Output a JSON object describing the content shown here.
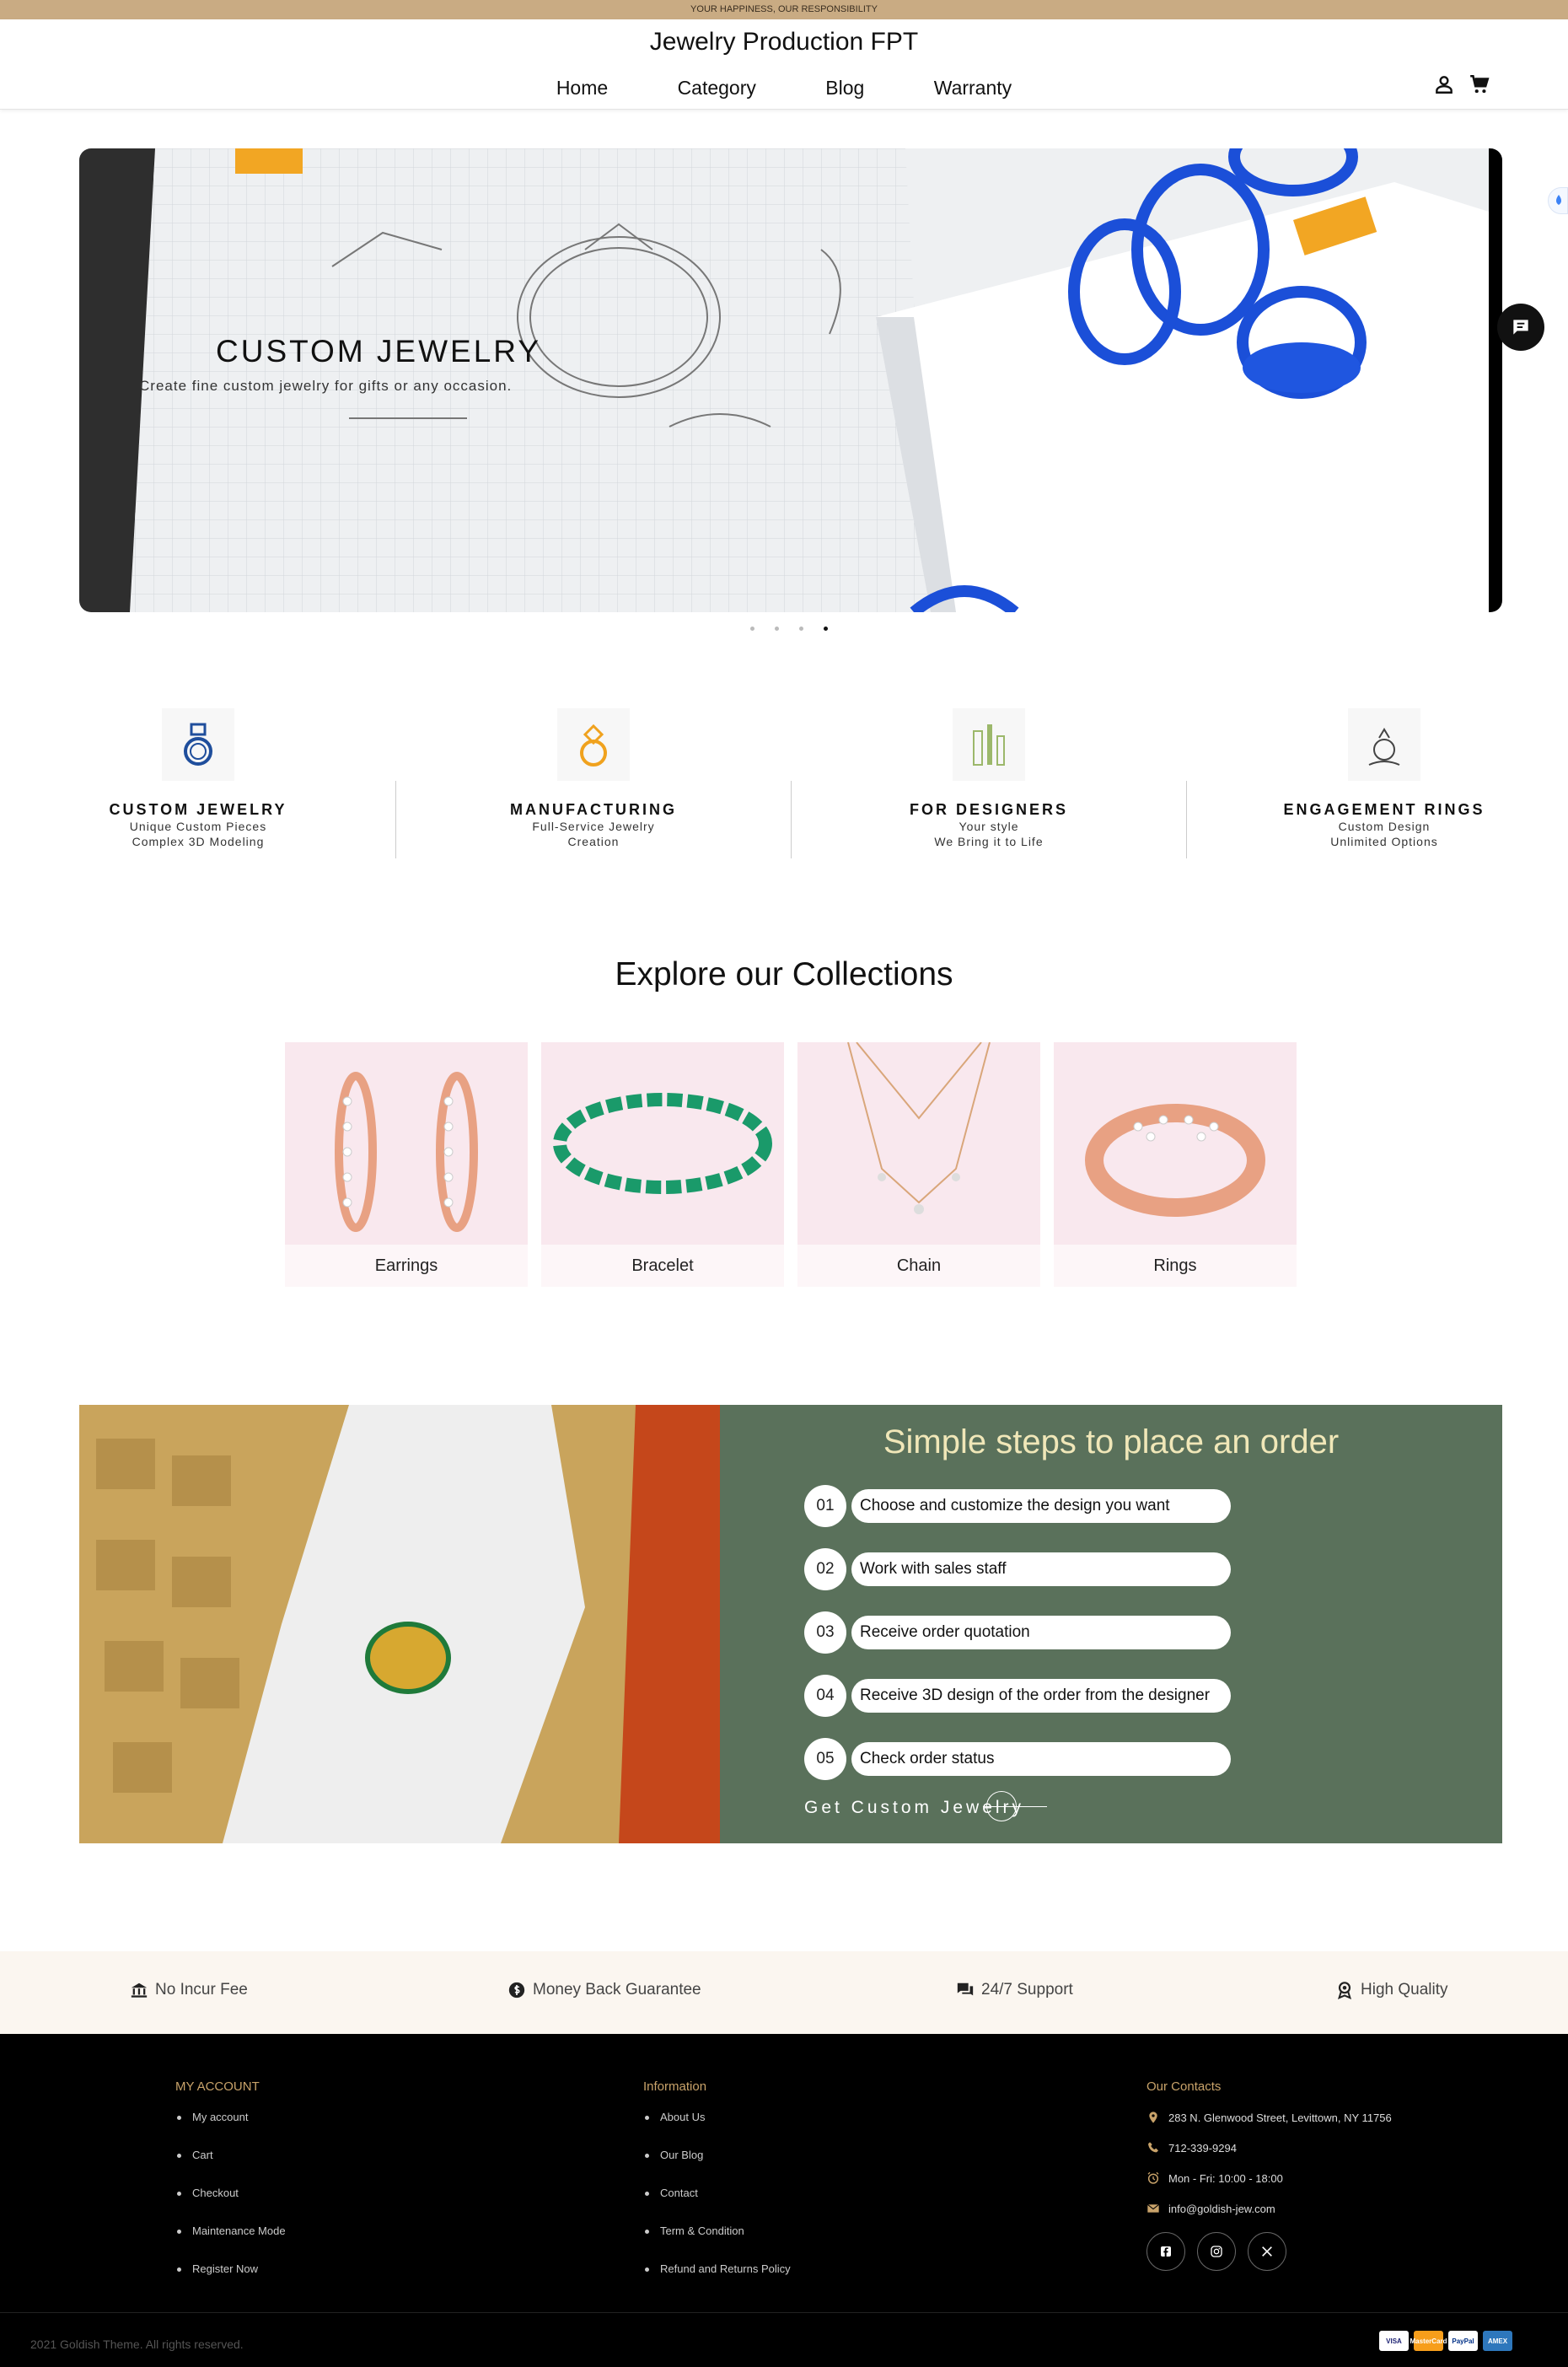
{
  "announcement": "YOUR HAPPINESS, OUR RESPONSIBILITY",
  "header": {
    "brand": "Jewelry Production FPT",
    "nav": [
      "Home",
      "Category",
      "Blog",
      "Warranty"
    ],
    "icons": [
      "account-icon",
      "cart-icon"
    ]
  },
  "hero": {
    "title": "CUSTOM JEWELRY",
    "subtitle": "Create fine custom jewelry for gifts or any occasion.",
    "slides_count": 4,
    "active_slide": 4
  },
  "features": [
    {
      "title": "CUSTOM JEWELRY",
      "line1": "Unique Custom Pieces",
      "line2": "Complex 3D Modeling",
      "icon": "ring-icon"
    },
    {
      "title": "MANUFACTURING",
      "line1": "Full-Service Jewelry",
      "line2": "Creation",
      "icon": "jeweled-ring-icon"
    },
    {
      "title": "FOR DESIGNERS",
      "line1": "Your style",
      "line2": "We Bring it to Life",
      "icon": "design-tools-icon"
    },
    {
      "title": "ENGAGEMENT RINGS",
      "line1": "Custom Design",
      "line2": "Unlimited Options",
      "icon": "ring-box-icon"
    }
  ],
  "collections": {
    "title": "Explore our Collections",
    "items": [
      "Earrings",
      "Bracelet",
      "Chain",
      "Rings"
    ]
  },
  "steps": {
    "title": "Simple steps to place an order",
    "items": [
      {
        "num": "01",
        "text": "Choose and customize the design you want"
      },
      {
        "num": "02",
        "text": "Work with sales staff"
      },
      {
        "num": "03",
        "text": "Receive order quotation"
      },
      {
        "num": "04",
        "text": "Receive 3D design of the order from the designer"
      },
      {
        "num": "05",
        "text": "Check order status"
      }
    ],
    "cta": "Get Custom Jewelry"
  },
  "perks": [
    {
      "label": "No Incur Fee",
      "icon": "bank-icon"
    },
    {
      "label": "Money Back Guarantee",
      "icon": "dollar-circle-icon"
    },
    {
      "label": "24/7 Support",
      "icon": "chat-bubbles-icon"
    },
    {
      "label": "High Quality",
      "icon": "award-ribbon-icon"
    }
  ],
  "footer": {
    "account": {
      "heading": "MY ACCOUNT",
      "links": [
        "My account",
        "Cart",
        "Checkout",
        "Maintenance Mode",
        "Register Now"
      ]
    },
    "information": {
      "heading": "Information",
      "links": [
        "About Us",
        "Our Blog",
        "Contact",
        "Term & Condition",
        "Refund and Returns Policy"
      ]
    },
    "contacts": {
      "heading": "Our Contacts",
      "address": "283 N. Glenwood Street, Levittown, NY 11756",
      "phone": "712-339-9294",
      "hours": "Mon - Fri: 10:00 - 18:00",
      "email": "info@goldish-jew.com"
    },
    "social": [
      "facebook-icon",
      "instagram-icon",
      "x-icon"
    ],
    "copyright": "2021 Goldish Theme. All rights reserved.",
    "payments": [
      "VISA",
      "MasterCard",
      "PayPal",
      "AMEX"
    ]
  },
  "colors": {
    "topbar": "#c9ab83",
    "steps_panel": "#5a715b",
    "steps_title": "#f0e7b8",
    "footer_heading": "#c9a36a"
  }
}
